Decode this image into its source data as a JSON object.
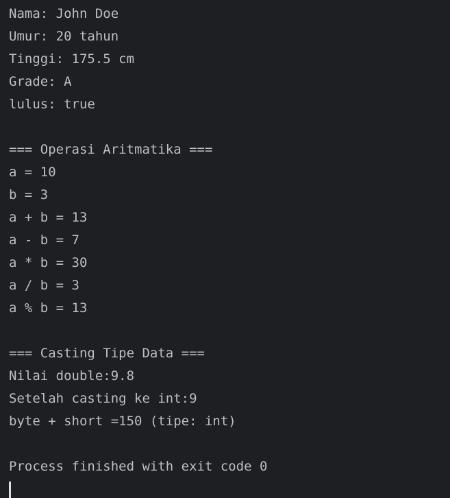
{
  "console": {
    "lines": [
      "Nama: John Doe",
      "Umur: 20 tahun",
      "Tinggi: 175.5 cm",
      "Grade: A",
      "lulus: true",
      "",
      "=== Operasi Aritmatika ===",
      "a = 10",
      "b = 3",
      "a + b = 13",
      "a - b = 7",
      "a * b = 30",
      "a / b = 3",
      "a % b = 13",
      "",
      "=== Casting Tipe Data ===",
      "Nilai double:9.8",
      "Setelah casting ke int:9",
      "byte + short =150 (tipe: int)",
      "",
      "Process finished with exit code 0"
    ]
  },
  "colors": {
    "background": "#1e1f22",
    "text": "#bcbec4",
    "cursor": "#dfe1e5"
  }
}
